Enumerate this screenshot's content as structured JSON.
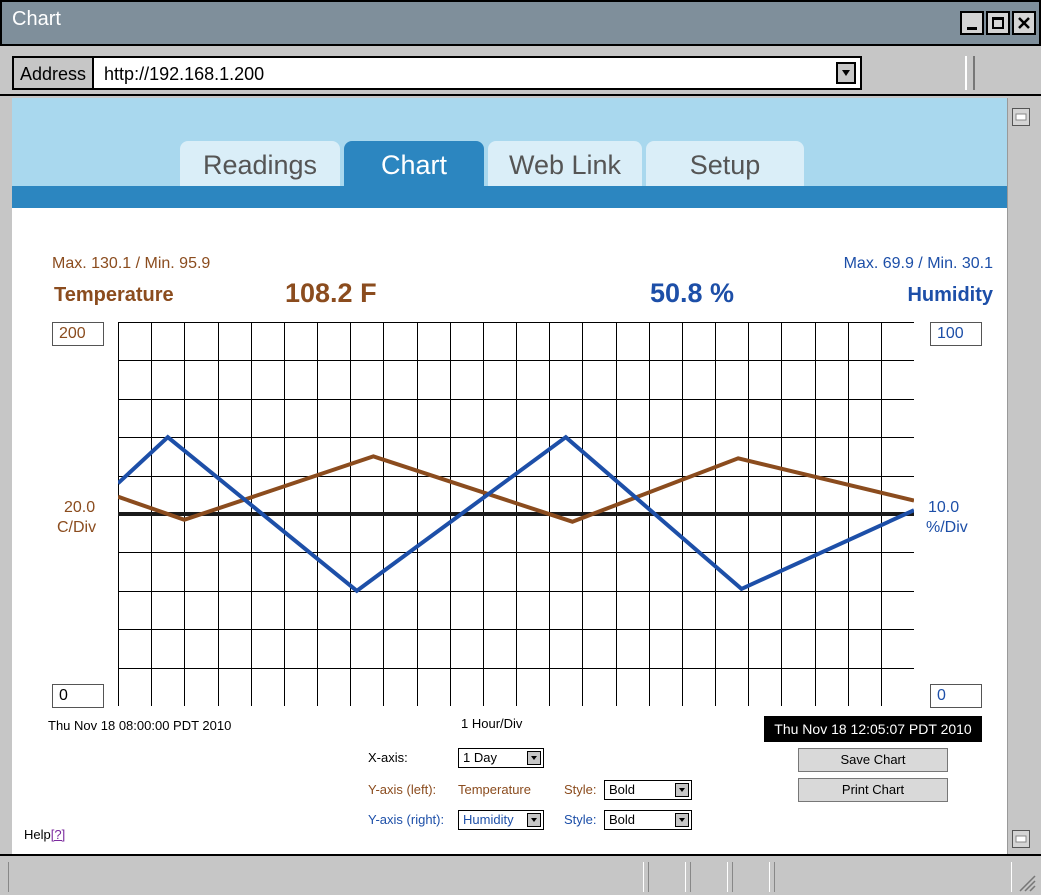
{
  "window": {
    "title": "Chart"
  },
  "address": {
    "label": "Address",
    "url": "http://192.168.1.200"
  },
  "tabs": [
    {
      "label": "Readings",
      "active": false
    },
    {
      "label": "Chart",
      "active": true
    },
    {
      "label": "Web Link",
      "active": false
    },
    {
      "label": "Setup",
      "active": false
    }
  ],
  "temperature": {
    "label": "Temperature",
    "value": "108.2 F",
    "maxmin": "Max. 130.1 / Min. 95.9",
    "scale_top": "200",
    "scale_bottom": "0",
    "div_value": "20.0",
    "div_unit": "C/Div",
    "color": "#8b4c1e"
  },
  "humidity": {
    "label": "Humidity",
    "value": "50.8 %",
    "maxmin": "Max. 69.9 / Min. 30.1",
    "scale_top": "100",
    "scale_bottom": "0",
    "div_value": "10.0",
    "div_unit": "%/Div",
    "color": "#1d4fa8"
  },
  "time": {
    "start": "Thu Nov 18 08:00:00 PDT 2010",
    "division": "1 Hour/Div",
    "current": "Thu Nov 18 12:05:07 PDT 2010"
  },
  "controls": {
    "xaxis_label": "X-axis:",
    "xaxis_value": "1 Day",
    "yleft_label": "Y-axis (left):",
    "yleft_value": "Temperature",
    "yleft_style_label": "Style:",
    "yleft_style_value": "Bold",
    "yright_label": "Y-axis (right):",
    "yright_value": "Humidity",
    "yright_style_label": "Style:",
    "yright_style_value": "Bold"
  },
  "buttons": {
    "save": "Save Chart",
    "print": "Print Chart"
  },
  "help": {
    "label": "Help",
    "link": "[?]"
  },
  "chart_data": {
    "type": "line",
    "x_divisions": 24,
    "y_divisions": 10,
    "reference_value": 100,
    "series": [
      {
        "name": "Temperature",
        "axis": "left",
        "ylim": [
          0,
          200
        ],
        "color": "#8b4c1e",
        "points": [
          [
            0,
            109
          ],
          [
            2,
            97
          ],
          [
            7.7,
            130
          ],
          [
            13.7,
            96
          ],
          [
            18.7,
            129
          ],
          [
            24,
            107
          ]
        ]
      },
      {
        "name": "Humidity",
        "axis": "right",
        "ylim": [
          0,
          100
        ],
        "color": "#1d4fa8",
        "points": [
          [
            0,
            58
          ],
          [
            1.5,
            70
          ],
          [
            7.2,
            30
          ],
          [
            13.5,
            70
          ],
          [
            18.8,
            30.5
          ],
          [
            24,
            51
          ]
        ]
      }
    ]
  }
}
